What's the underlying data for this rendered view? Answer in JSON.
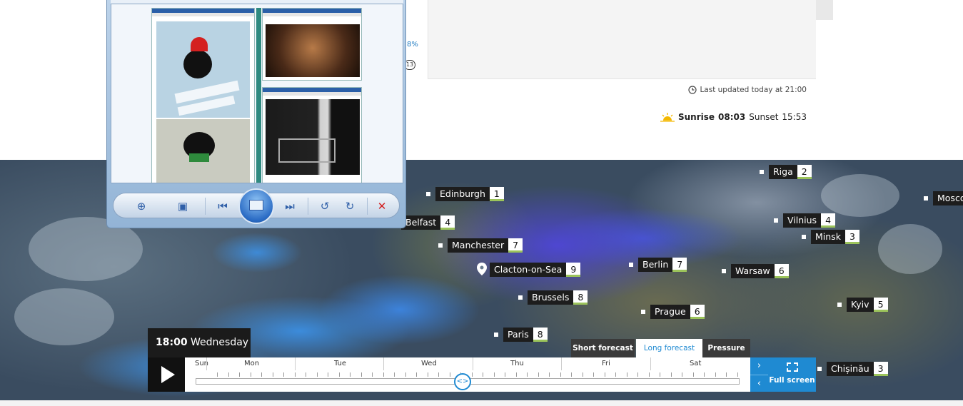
{
  "page": {
    "last_updated": "Last updated today at 21:00",
    "sunrise_label": "Sunrise",
    "sunrise_time": "08:03",
    "sunset_label": "Sunset",
    "sunset_time": "15:53",
    "peek_percent": "8%",
    "peek_badge": "13"
  },
  "map": {
    "cities": [
      {
        "name": "Riga",
        "temp": "2"
      },
      {
        "name": "Edinburgh",
        "temp": "1"
      },
      {
        "name": "Moscow",
        "temp": ""
      },
      {
        "name": "Belfast",
        "temp": "4"
      },
      {
        "name": "Vilnius",
        "temp": "4"
      },
      {
        "name": "Minsk",
        "temp": "3"
      },
      {
        "name": "Manchester",
        "temp": "7"
      },
      {
        "name": "Berlin",
        "temp": "7"
      },
      {
        "name": "Warsaw",
        "temp": "6"
      },
      {
        "name": "Clacton-on-Sea",
        "temp": "9"
      },
      {
        "name": "Brussels",
        "temp": "8"
      },
      {
        "name": "Kyiv",
        "temp": "5"
      },
      {
        "name": "Prague",
        "temp": "6"
      },
      {
        "name": "Paris",
        "temp": "8"
      },
      {
        "name": "Chișinău",
        "temp": "3"
      }
    ]
  },
  "controls": {
    "time": "18:00",
    "day": "Wednesday",
    "days": [
      "Sun",
      "Mon",
      "Tue",
      "Wed",
      "Thu",
      "Fri",
      "Sat"
    ],
    "tabs": {
      "short": "Short forecast",
      "long": "Long forecast",
      "pressure": "Pressure"
    },
    "active_tab": "long",
    "full_screen": "Full screen",
    "knob_icon": "<>"
  },
  "colors": {
    "accent": "#1f8ad2",
    "temp_underline": "#9cc45b"
  }
}
